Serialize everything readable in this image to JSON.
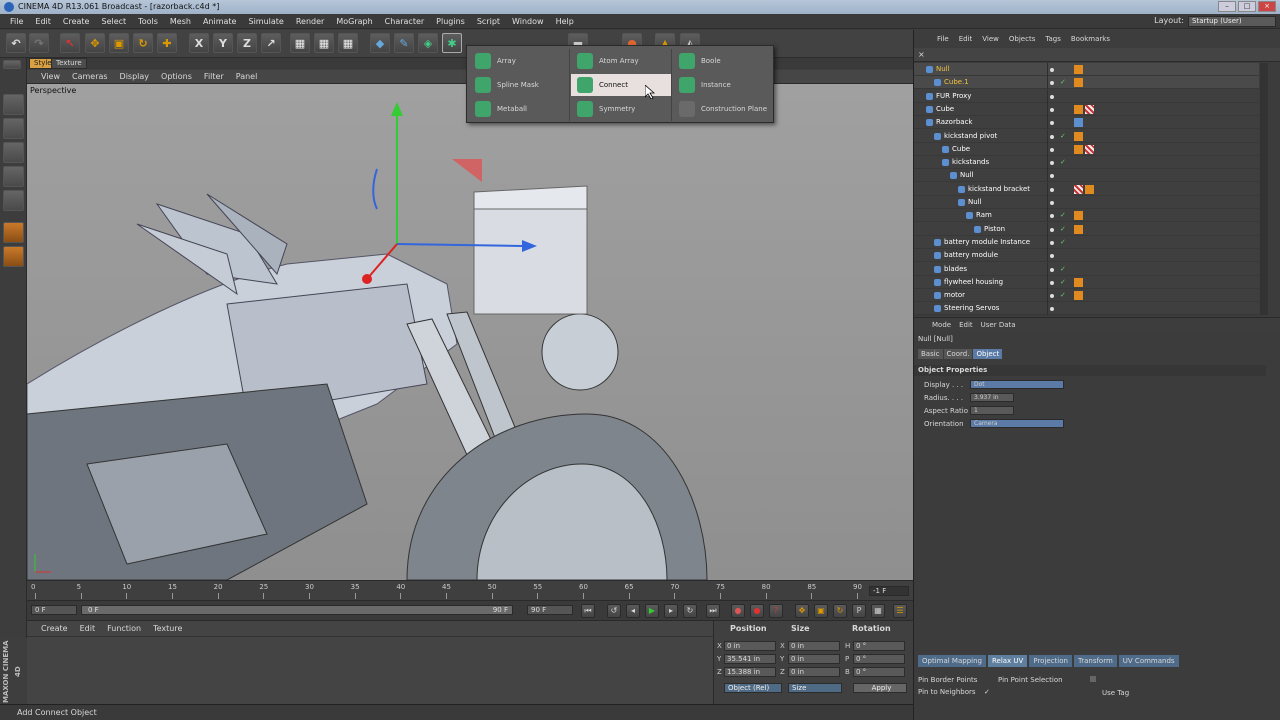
{
  "window": {
    "title": "CINEMA 4D R13.061 Broadcast - [razorback.c4d *]"
  },
  "menubar": [
    "File",
    "Edit",
    "Create",
    "Select",
    "Tools",
    "Mesh",
    "Animate",
    "Simulate",
    "Render",
    "MoGraph",
    "Character",
    "Plugins",
    "Script",
    "Window",
    "Help"
  ],
  "layout": {
    "label": "Layout:",
    "value": "Startup (User)"
  },
  "viewport": {
    "tabs": [
      "Style",
      "Texture"
    ],
    "menu": [
      "View",
      "Cameras",
      "Display",
      "Options",
      "Filter",
      "Panel"
    ],
    "camera_label": "Perspective"
  },
  "popup_menu": {
    "items": [
      {
        "label": "Array",
        "icon": "array-icon"
      },
      {
        "label": "Spline Mask",
        "icon": "spline-mask-icon"
      },
      {
        "label": "Metaball",
        "icon": "metaball-icon"
      },
      {
        "label": "Atom Array",
        "icon": "atom-array-icon"
      },
      {
        "label": "Connect",
        "icon": "connect-icon",
        "highlighted": true
      },
      {
        "label": "Symmetry",
        "icon": "symmetry-icon"
      },
      {
        "label": "Boole",
        "icon": "boole-icon"
      },
      {
        "label": "Instance",
        "icon": "instance-icon"
      },
      {
        "label": "Construction Plane",
        "icon": "construction-plane-icon"
      }
    ]
  },
  "timeline": {
    "ticks": [
      "0",
      "5",
      "10",
      "15",
      "20",
      "25",
      "30",
      "35",
      "40",
      "45",
      "50",
      "55",
      "60",
      "65",
      "70",
      "75",
      "80",
      "85",
      "90"
    ],
    "current_frame": "-1 F",
    "start_field": "0 F",
    "range_start": "0 F",
    "range_end": "90 F",
    "end_field": "90 F"
  },
  "material_manager": {
    "menu": [
      "Create",
      "Edit",
      "Function",
      "Texture"
    ]
  },
  "coordinates": {
    "headers": [
      "Position",
      "Size",
      "Rotation"
    ],
    "rows": [
      {
        "axis": "X",
        "position": "0 in",
        "size_axis": "X",
        "size": "0 in",
        "rot_axis": "H",
        "rotation": "0 °"
      },
      {
        "axis": "Y",
        "position": "35.541 in",
        "size_axis": "Y",
        "size": "0 in",
        "rot_axis": "P",
        "rotation": "0 °"
      },
      {
        "axis": "Z",
        "position": "15.388 in",
        "size_axis": "Z",
        "size": "0 in",
        "rot_axis": "B",
        "rotation": "0 °"
      }
    ],
    "mode_select": "Object (Rel)",
    "size_select": "Size",
    "apply_label": "Apply"
  },
  "branding": "MAXON CINEMA 4D",
  "status": "Add Connect Object",
  "object_manager": {
    "menu": [
      "File",
      "Edit",
      "View",
      "Objects",
      "Tags",
      "Bookmarks"
    ],
    "objects": [
      {
        "name": "Null",
        "indent": 0,
        "color": "#f0c040",
        "check": false,
        "tags": [
          "orange"
        ]
      },
      {
        "name": "Cube.1",
        "indent": 1,
        "color": "#f0c040",
        "check": true,
        "tags": [
          "orange"
        ]
      },
      {
        "name": "FUR Proxy",
        "indent": 0,
        "color": "#ffffff",
        "check": false,
        "tags": []
      },
      {
        "name": "Cube",
        "indent": 0,
        "color": "#ffffff",
        "check": false,
        "tags": [
          "orange",
          "checker"
        ]
      },
      {
        "name": "Razorback",
        "indent": 0,
        "color": "#ffffff",
        "check": false,
        "tags": [
          "blue"
        ]
      },
      {
        "name": "kickstand pivot",
        "indent": 1,
        "color": "#ffffff",
        "check": true,
        "tags": [
          "orange"
        ]
      },
      {
        "name": "Cube",
        "indent": 2,
        "color": "#ffffff",
        "check": false,
        "tags": [
          "orange",
          "checker"
        ]
      },
      {
        "name": "kickstands",
        "indent": 2,
        "color": "#ffffff",
        "check": true,
        "tags": []
      },
      {
        "name": "Null",
        "indent": 3,
        "color": "#ffffff",
        "check": false,
        "tags": []
      },
      {
        "name": "kickstand bracket",
        "indent": 4,
        "color": "#ffffff",
        "check": false,
        "tags": [
          "checker",
          "orange"
        ]
      },
      {
        "name": "Null",
        "indent": 4,
        "color": "#ffffff",
        "check": false,
        "tags": []
      },
      {
        "name": "Ram",
        "indent": 5,
        "color": "#ffffff",
        "check": true,
        "tags": [
          "orange"
        ]
      },
      {
        "name": "Piston",
        "indent": 6,
        "color": "#ffffff",
        "check": true,
        "tags": [
          "orange"
        ]
      },
      {
        "name": "battery module Instance",
        "indent": 1,
        "color": "#ffffff",
        "check": true,
        "tags": []
      },
      {
        "name": "battery module",
        "indent": 1,
        "color": "#ffffff",
        "check": false,
        "tags": []
      },
      {
        "name": "blades",
        "indent": 1,
        "color": "#ffffff",
        "check": true,
        "tags": []
      },
      {
        "name": "flywheel housing",
        "indent": 1,
        "color": "#ffffff",
        "check": true,
        "tags": [
          "orange"
        ]
      },
      {
        "name": "motor",
        "indent": 1,
        "color": "#ffffff",
        "check": true,
        "tags": [
          "orange"
        ]
      },
      {
        "name": "Steering Servos",
        "indent": 1,
        "color": "#ffffff",
        "check": false,
        "tags": []
      }
    ]
  },
  "attribute_manager": {
    "menu": [
      "Mode",
      "Edit",
      "User Data"
    ],
    "title": "Null [Null]",
    "tabs": [
      "Basic",
      "Coord.",
      "Object"
    ],
    "active_tab": "Object",
    "section": "Object Properties",
    "props": [
      {
        "label": "Display . . .",
        "value": "Dot"
      },
      {
        "label": "Radius. . . .",
        "value": "3.937 in"
      },
      {
        "label": "Aspect Ratio",
        "value": "1"
      },
      {
        "label": "Orientation",
        "value": "Camera"
      }
    ]
  },
  "uv_panel": {
    "tabs": [
      "Optimal Mapping",
      "Relax UV",
      "Projection",
      "Transform",
      "UV Commands"
    ],
    "active_tab": "Relax UV",
    "options": [
      "Pin Border Points",
      "Pin to Neighbors",
      "Pin Point Selection",
      "Use Tag"
    ]
  }
}
